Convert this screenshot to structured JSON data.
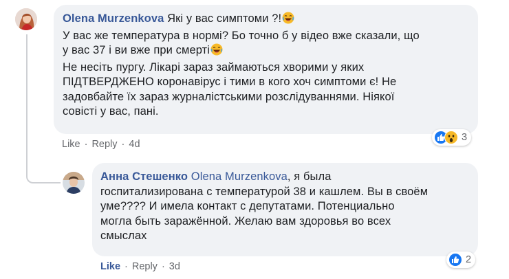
{
  "comment1": {
    "author": "Olena Murzenkova",
    "text_first": " Які у вас симптоми ?!",
    "text_lines": [
      "У вас же температура в нормі? Бо точно б у відео вже сказали, що",
      "у вас 37 і ви вже при смерті"
    ],
    "text_rest": [
      "Не несіть пургу. Лікарі зараз займаються хворими у яких",
      "ПІДТВЕРДЖЕНО коронавірус і тими в кого хоч симптоми є! Не",
      "задовбайте їх зараз журналістськими розслідуваннями. Ніякої",
      "совісті у вас, пані."
    ],
    "actions": {
      "like": "Like",
      "reply": "Reply",
      "time": "4d",
      "dot": "·"
    },
    "reactions": {
      "icons": [
        "like-reaction-icon",
        "wow-reaction-icon"
      ],
      "count": "3"
    },
    "emoji": "laughing-emoji-icon"
  },
  "comment2": {
    "author": "Анна Стешенко",
    "mention": "Olena Murzenkova",
    "text_first": ", я была",
    "text_lines": [
      "госпитализирована с температурой 38 и кашлем. Вы в своём",
      "уме???? И имела контакт с депутатами. Потенциально",
      "могла быть заражённой. Желаю вам здоровья во всех",
      "смыслах"
    ],
    "actions": {
      "like": "Like",
      "reply": "Reply",
      "time": "3d",
      "dot": "·"
    },
    "reactions": {
      "icons": [
        "like-reaction-icon"
      ],
      "count": "2"
    }
  },
  "colors": {
    "bubble": "#f0f2f5",
    "link": "#385898",
    "meta": "#65676b"
  }
}
